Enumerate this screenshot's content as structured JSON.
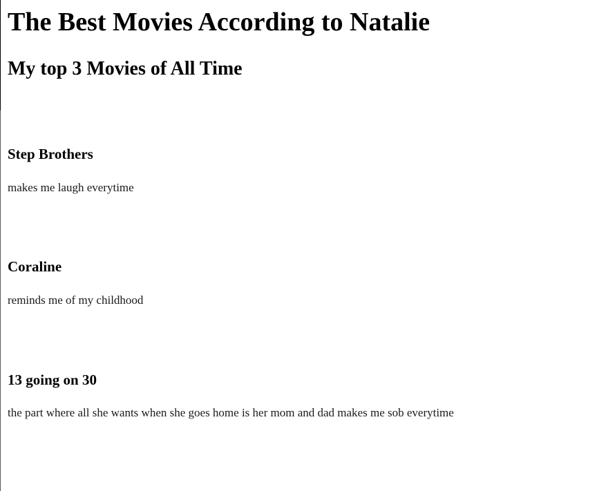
{
  "page": {
    "title": "The Best Movies According to Natalie",
    "subtitle": "My top 3 Movies of All Time"
  },
  "movies": [
    {
      "title": "Step Brothers",
      "description": "makes me laugh everytime"
    },
    {
      "title": "Coraline",
      "description": "reminds me of my childhood"
    },
    {
      "title": "13 going on 30",
      "description": "the part where all she wants when she goes home is her mom and dad makes me sob everytime"
    }
  ]
}
